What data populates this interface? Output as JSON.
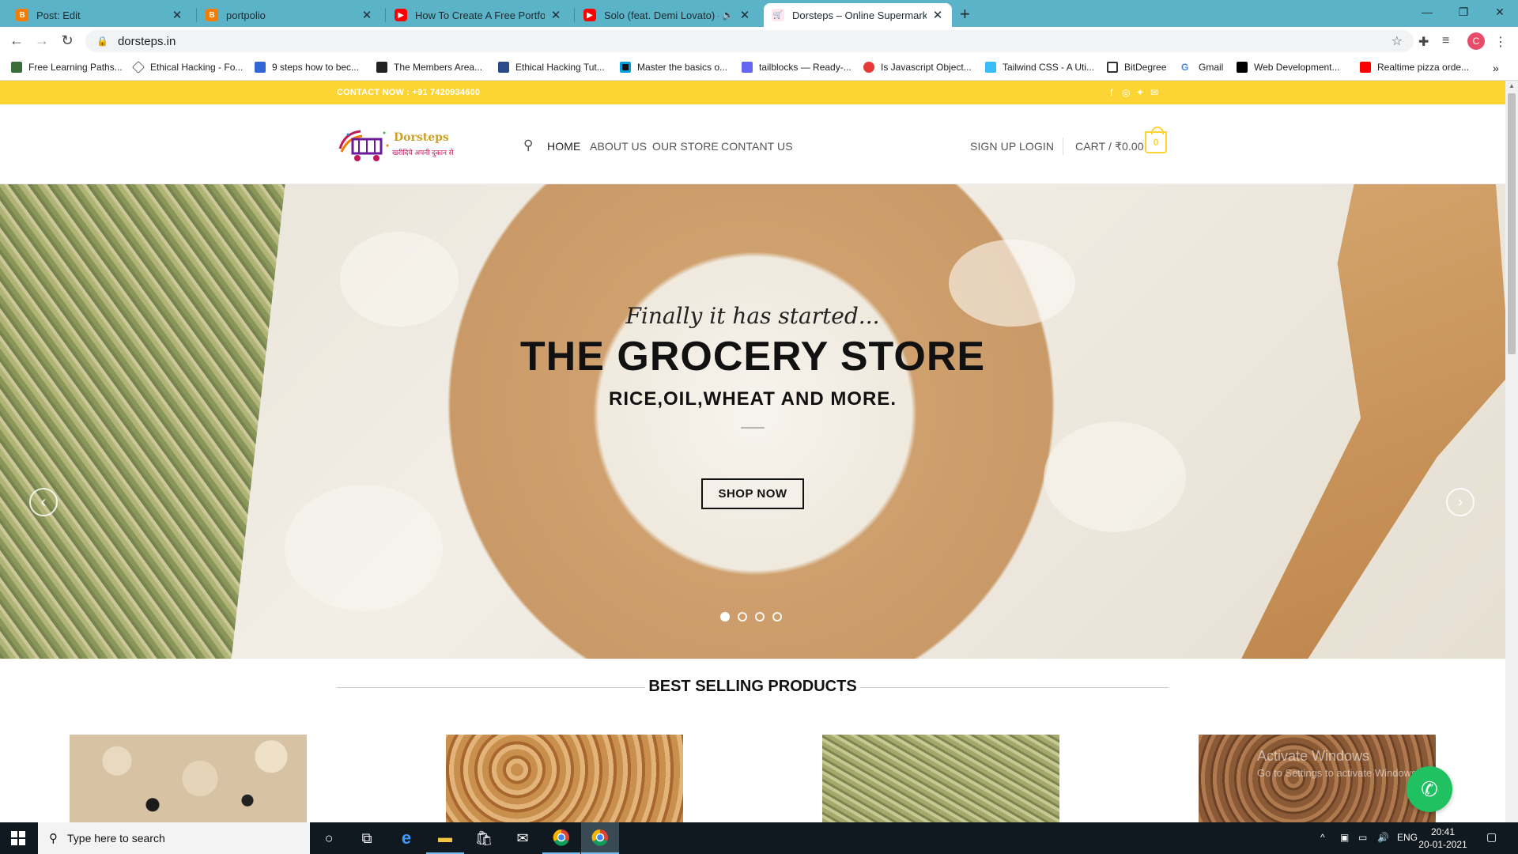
{
  "browser": {
    "tabs": [
      {
        "title": "Post: Edit",
        "icon": "blogger-icon",
        "color": "#f57c00"
      },
      {
        "title": "portpolio",
        "icon": "blogger-icon",
        "color": "#f57c00"
      },
      {
        "title": "How To Create A Free Portfolio W",
        "icon": "youtube-icon",
        "color": "#ff0000"
      },
      {
        "title": "Solo (feat. Demi Lovato) - Yo",
        "icon": "youtube-icon",
        "color": "#ff0000"
      },
      {
        "title": "Dorsteps – Online Supermarket",
        "icon": "dorsteps-icon",
        "color": "#c2185b"
      }
    ],
    "url": "dorsteps.in",
    "profile_initial": "C",
    "bookmarks": [
      "Free Learning Paths...",
      "Ethical Hacking - Fo...",
      "9 steps how to bec...",
      "The Members Area...",
      "Ethical Hacking Tut...",
      "Master the basics o...",
      "tailblocks — Ready-...",
      "Is Javascript Object...",
      "Tailwind CSS - A Uti...",
      "BitDegree",
      "Gmail",
      "Web Development...",
      "Realtime pizza orde..."
    ]
  },
  "site": {
    "contact": "CONTACT NOW : +91 7420934600",
    "logo": {
      "brand": "Dorsteps",
      "tagline": "खरीदिये अपनी दुकान से"
    },
    "nav": [
      "HOME",
      "ABOUT US",
      "OUR STORE",
      "CONTANT US"
    ],
    "account": {
      "signup": "SIGN UP",
      "login": "LOGIN",
      "cart": "CART / ₹0.00",
      "cart_count": "0"
    },
    "hero": {
      "subtitle": "Finally it has started...",
      "title": "THE GROCERY STORE",
      "line2": "RICE,OIL,WHEAT AND MORE.",
      "button": "SHOP NOW"
    },
    "section_title": "BEST SELLING PRODUCTS",
    "watermark": {
      "line1": "Activate Windows",
      "line2": "Go to Settings to activate Windows."
    },
    "colors": {
      "accent": "#fcd535",
      "whatsapp": "#1fc160"
    }
  },
  "taskbar": {
    "search_placeholder": "Type here to search",
    "lang": "ENG",
    "time": "20:41",
    "date": "20-01-2021"
  }
}
